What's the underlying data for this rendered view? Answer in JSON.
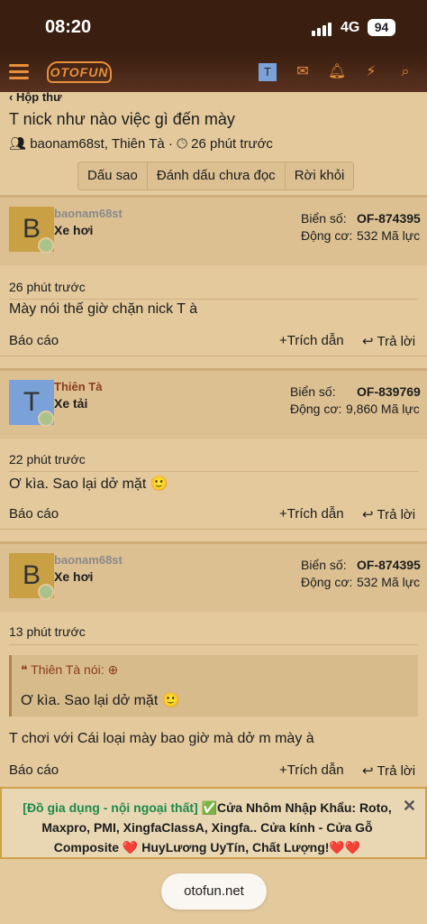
{
  "status": {
    "time": "08:20",
    "network": "4G",
    "battery": "94"
  },
  "appbar": {
    "logo": "OTOFUN",
    "avatar_letter": "T",
    "icons": [
      "menu-icon",
      "mail-icon",
      "bell-icon",
      "bolt-icon",
      "search-icon"
    ]
  },
  "thread": {
    "breadcrumb": "Hộp thư",
    "title": "T nick như nào việc gì đến mày",
    "participants": "baonam68st, Thiên Tà",
    "time": "26 phút trước",
    "tabs": [
      "Dấu sao",
      "Đánh dấu chưa đọc",
      "Rời khỏi"
    ]
  },
  "labels": {
    "plate": "Biển số:",
    "engine": "Động cơ:",
    "report": "Báo cáo",
    "quote": "Trích dẫn",
    "reply": "Trả lời"
  },
  "posts": [
    {
      "avatar": "B",
      "avatar_color": "#c9a044",
      "name": "baonam68st",
      "name_color": "#8a8a8a",
      "type": "Xe hơi",
      "plate": "OF-874395",
      "engine": "532 Mã lực",
      "time": "26 phút trước",
      "text": "Mày nói thế giờ chặn nick T à"
    },
    {
      "avatar": "T",
      "avatar_color": "#7aa2d8",
      "name": "Thiên Tà",
      "name_color": "#8a3c1e",
      "type": "Xe tải",
      "plate": "OF-839769",
      "engine": "9,860 Mã lực",
      "time": "22 phút trước",
      "text": "Ơ kìa. Sao lại dở mặt 🙂"
    },
    {
      "avatar": "B",
      "avatar_color": "#c9a044",
      "name": "baonam68st",
      "name_color": "#8a8a8a",
      "type": "Xe hơi",
      "plate": "OF-874395",
      "engine": "532 Mã lực",
      "time": "13 phút trước",
      "quote_author": "Thiên Tà nói:",
      "quote_text": "Ơ kìa. Sao lại dở mặt 🙂",
      "text": "T chơi với Cái loại mày bao giờ mà dở m mày à"
    }
  ],
  "ad": {
    "tag": "[Đồ gia dụng - nội ngoại thất]",
    "text": "✅Cửa Nhôm Nhập Khẩu: Roto, Maxpro, PMI, XingfaClassA, Xingfa.. Cửa kính - Cửa Gỗ Composite ❤️ HuyLương UyTín, Chất Lượng!❤️❤️"
  },
  "url": "otofun.net"
}
